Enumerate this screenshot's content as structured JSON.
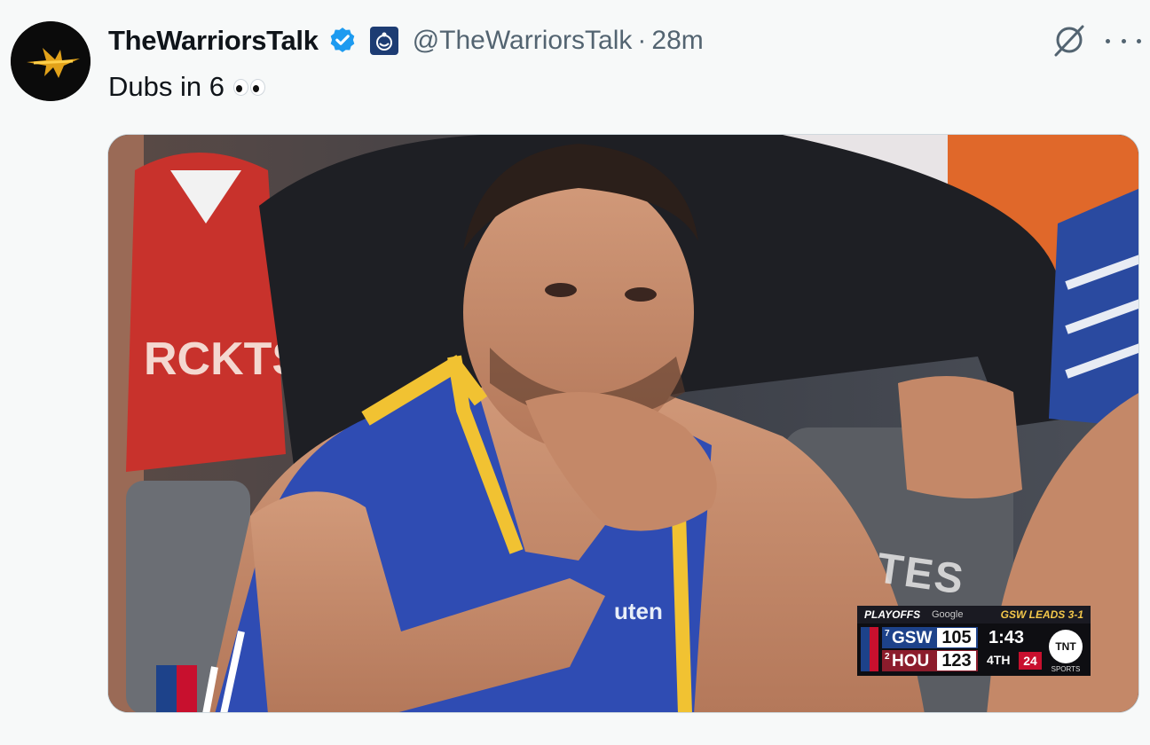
{
  "tweet": {
    "display_name": "TheWarriorsTalk",
    "handle": "@TheWarriorsTalk",
    "separator": "·",
    "time": "28m",
    "text": "Dubs in 6",
    "emoji_icon": "eyes-emoji-icon",
    "verified_icon": "verified-badge-icon",
    "affiliate_icon": "affiliate-badge-icon",
    "grok_icon": "grok-icon",
    "more_icon": "more-options-icon"
  },
  "media": {
    "jersey_patch": "uten",
    "seat_text": "TES",
    "scorebug": {
      "playoffs_label": "PLAYOFFS",
      "sponsor_label": "Google",
      "series_label": "GSW LEADS 3-1",
      "teams": [
        {
          "seed": "7",
          "abbr": "GSW",
          "score": "105"
        },
        {
          "seed": "2",
          "abbr": "HOU",
          "score": "123"
        }
      ],
      "clock": "1:43",
      "period": "4TH",
      "shot_clock": "24",
      "network": "TNT",
      "network_sub": "SPORTS"
    }
  },
  "colors": {
    "verified": "#1d9bf0",
    "text_primary": "#0f1419",
    "text_secondary": "#536471",
    "warriors_blue": "#1d428a",
    "warriors_gold": "#f3c74a",
    "rockets_red": "#c8102e"
  }
}
